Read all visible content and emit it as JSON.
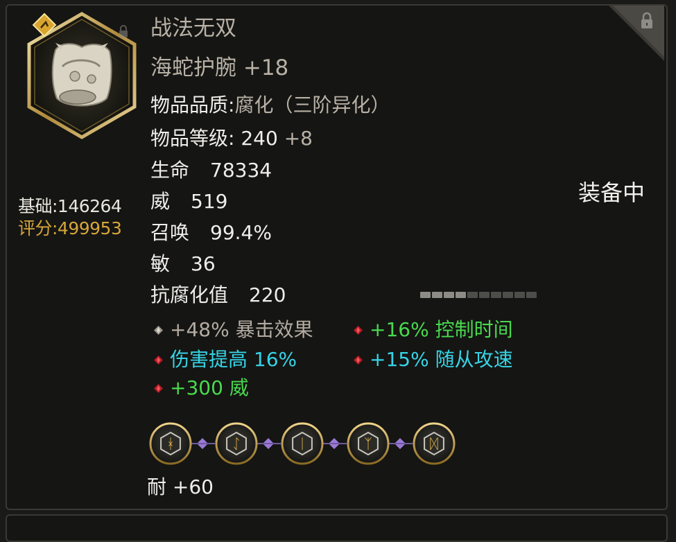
{
  "item": {
    "title": "战法无双",
    "name": "海蛇护腕 +18",
    "quality_label": "物品品质:",
    "quality_value": "腐化（三阶异化）",
    "level_label": "物品等级:",
    "level_value": "240",
    "level_bonus": "+8",
    "stats": [
      {
        "label": "生命",
        "value": "78334"
      },
      {
        "label": "威",
        "value": "519"
      },
      {
        "label": "召唤",
        "value": "99.4%"
      },
      {
        "label": "敏",
        "value": "36"
      },
      {
        "label": "抗腐化值",
        "value": "220"
      }
    ],
    "equipped_label": "装备中",
    "corruption_bar": {
      "segments": 10,
      "filled": 4
    }
  },
  "score": {
    "base": "基础:146264",
    "rating": "评分:499953"
  },
  "affixes": [
    {
      "text": "+48% 暴击效果",
      "color": "#b3aca2",
      "gem": "white-gem-icon"
    },
    {
      "text": "+16% 控制时间",
      "color": "#49d94f",
      "gem": "red-gem-icon"
    },
    {
      "text": "伤害提高 16%",
      "color": "#36d4e6",
      "gem": "red-gem-icon"
    },
    {
      "text": "+15% 随从攻速",
      "color": "#36d4e6",
      "gem": "red-gem-icon"
    },
    {
      "text": "+300 威",
      "color": "#49d94f",
      "gem": "red-gem-icon"
    }
  ],
  "sockets": [
    {
      "glyph": "ᚼ",
      "icon": "rune-socket-icon"
    },
    {
      "glyph": "ᛇ",
      "icon": "rune-socket-icon"
    },
    {
      "glyph": "ᛁ",
      "icon": "rune-socket-icon"
    },
    {
      "glyph": "ᛉ",
      "icon": "rune-socket-icon"
    },
    {
      "glyph": "ᛞ",
      "icon": "rune-socket-icon"
    }
  ],
  "durability": "耐  +60",
  "colors": {
    "accent_gold": "#d6a53a",
    "stat_text": "#efeeea",
    "muted_text": "#b8b1a6",
    "green_affix": "#49d94f",
    "cyan_affix": "#36d4e6",
    "socket_link": "#9a7ad6"
  }
}
